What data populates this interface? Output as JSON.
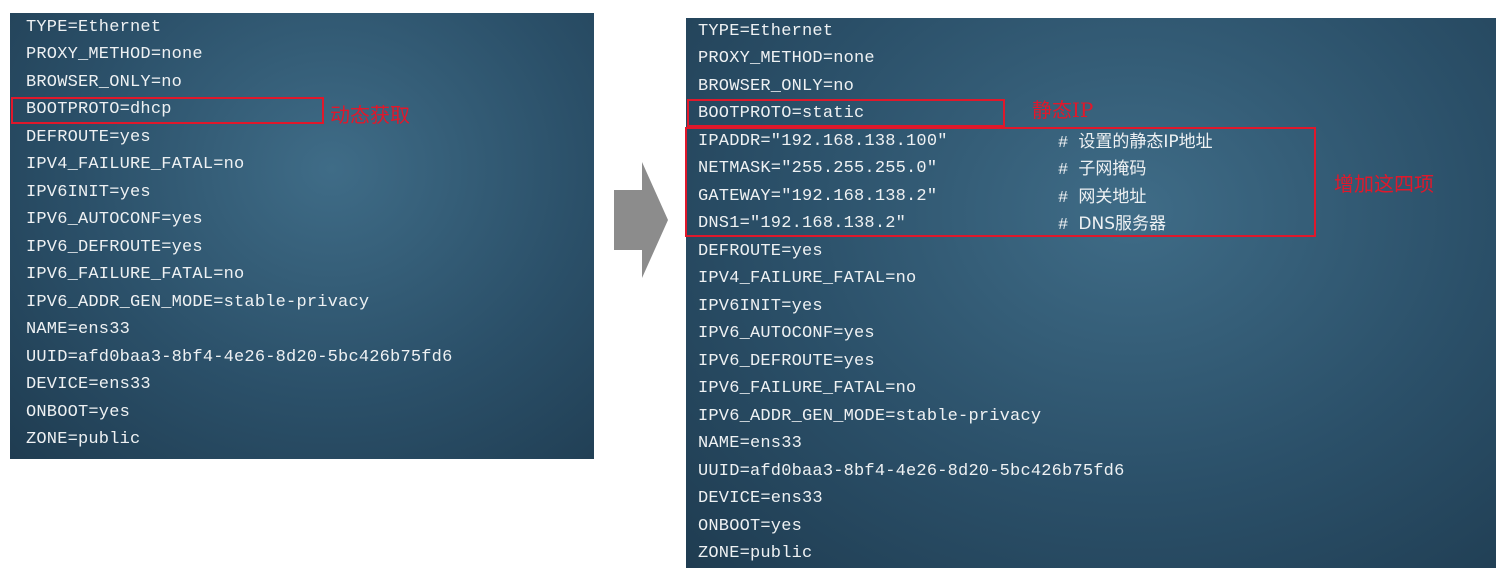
{
  "left_panel": {
    "lines": [
      "TYPE=Ethernet",
      "PROXY_METHOD=none",
      "BROWSER_ONLY=no",
      "BOOTPROTO=dhcp",
      "DEFROUTE=yes",
      "IPV4_FAILURE_FATAL=no",
      "IPV6INIT=yes",
      "IPV6_AUTOCONF=yes",
      "IPV6_DEFROUTE=yes",
      "IPV6_FAILURE_FATAL=no",
      "IPV6_ADDR_GEN_MODE=stable-privacy",
      "NAME=ens33",
      "UUID=afd0baa3-8bf4-4e26-8d20-5bc426b75fd6",
      "DEVICE=ens33",
      "ONBOOT=yes",
      "ZONE=public"
    ],
    "annotation": "动态获取"
  },
  "right_panel": {
    "lines_top": [
      "TYPE=Ethernet",
      "PROXY_METHOD=none",
      "BROWSER_ONLY=no",
      "BOOTPROTO=static"
    ],
    "added_lines": [
      {
        "text": "IPADDR=\"192.168.138.100\"",
        "comment_hash": "#",
        "comment": "设置的静态IP地址"
      },
      {
        "text": "NETMASK=\"255.255.255.0\"",
        "comment_hash": "#",
        "comment": "子网掩码"
      },
      {
        "text": "GATEWAY=\"192.168.138.2\"",
        "comment_hash": "#",
        "comment": "网关地址"
      },
      {
        "text": "DNS1=\"192.168.138.2\"",
        "comment_hash": "#",
        "comment": "DNS服务器"
      }
    ],
    "lines_bottom": [
      "DEFROUTE=yes",
      "IPV4_FAILURE_FATAL=no",
      "IPV6INIT=yes",
      "IPV6_AUTOCONF=yes",
      "IPV6_DEFROUTE=yes",
      "IPV6_FAILURE_FATAL=no",
      "IPV6_ADDR_GEN_MODE=stable-privacy",
      "NAME=ens33",
      "UUID=afd0baa3-8bf4-4e26-8d20-5bc426b75fd6",
      "DEVICE=ens33",
      "ONBOOT=yes",
      "ZONE=public"
    ],
    "annotation_static": "静态IP",
    "annotation_added": "增加这四项"
  },
  "colors": {
    "annotation_red": "#e0182b",
    "terminal_bg": "#2b5069",
    "terminal_text": "#eef1f3",
    "arrow_gray": "#8c8c8c"
  },
  "icons": {
    "transition": "right-arrow-icon"
  }
}
